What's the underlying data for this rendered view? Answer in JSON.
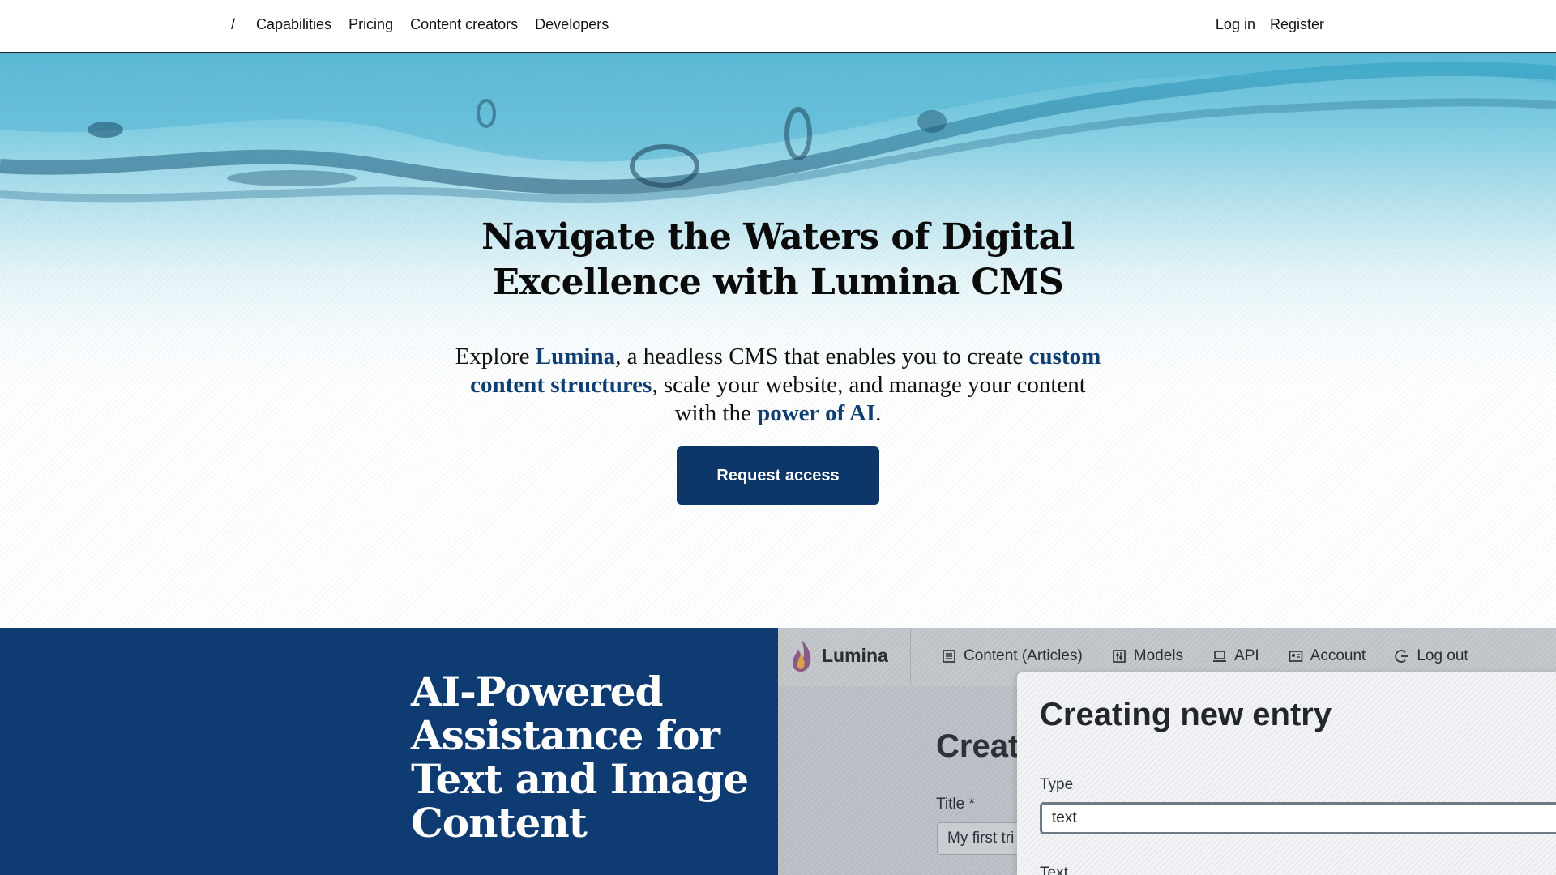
{
  "nav": {
    "home": "/",
    "links": [
      "Capabilities",
      "Pricing",
      "Content creators",
      "Developers"
    ],
    "login": "Log in",
    "register": "Register"
  },
  "hero": {
    "title": "Navigate the Waters of Digital Excellence with Lumina CMS",
    "lead": {
      "t1": "Explore ",
      "b1": "Lumina",
      "t2": ", a headless CMS that enables you to create ",
      "b2": "custom content structures",
      "t3": ", scale your website, and manage your content with the ",
      "b3": "power of AI",
      "t4": "."
    },
    "cta": "Request access"
  },
  "feature": {
    "title": "AI-Powered Assistance for Text and Image Content",
    "app": {
      "brand": "Lumina",
      "menu": [
        {
          "label": "Content (Articles)",
          "icon": "list-icon"
        },
        {
          "label": "Models",
          "icon": "sliders-icon"
        },
        {
          "label": "API",
          "icon": "laptop-icon"
        },
        {
          "label": "Account",
          "icon": "id-card-icon"
        },
        {
          "label": "Log out",
          "icon": "logout-icon"
        }
      ],
      "behind_title": "Creat",
      "behind_label": "Title *",
      "behind_value": "My first tri",
      "modal_title": "Creating new entry",
      "type_label": "Type",
      "type_value": "text",
      "text_label": "Text"
    }
  },
  "colors": {
    "brand_navy": "#0d3768",
    "feature_bg": "#0d3b72",
    "highlight": "#0e3e72"
  }
}
